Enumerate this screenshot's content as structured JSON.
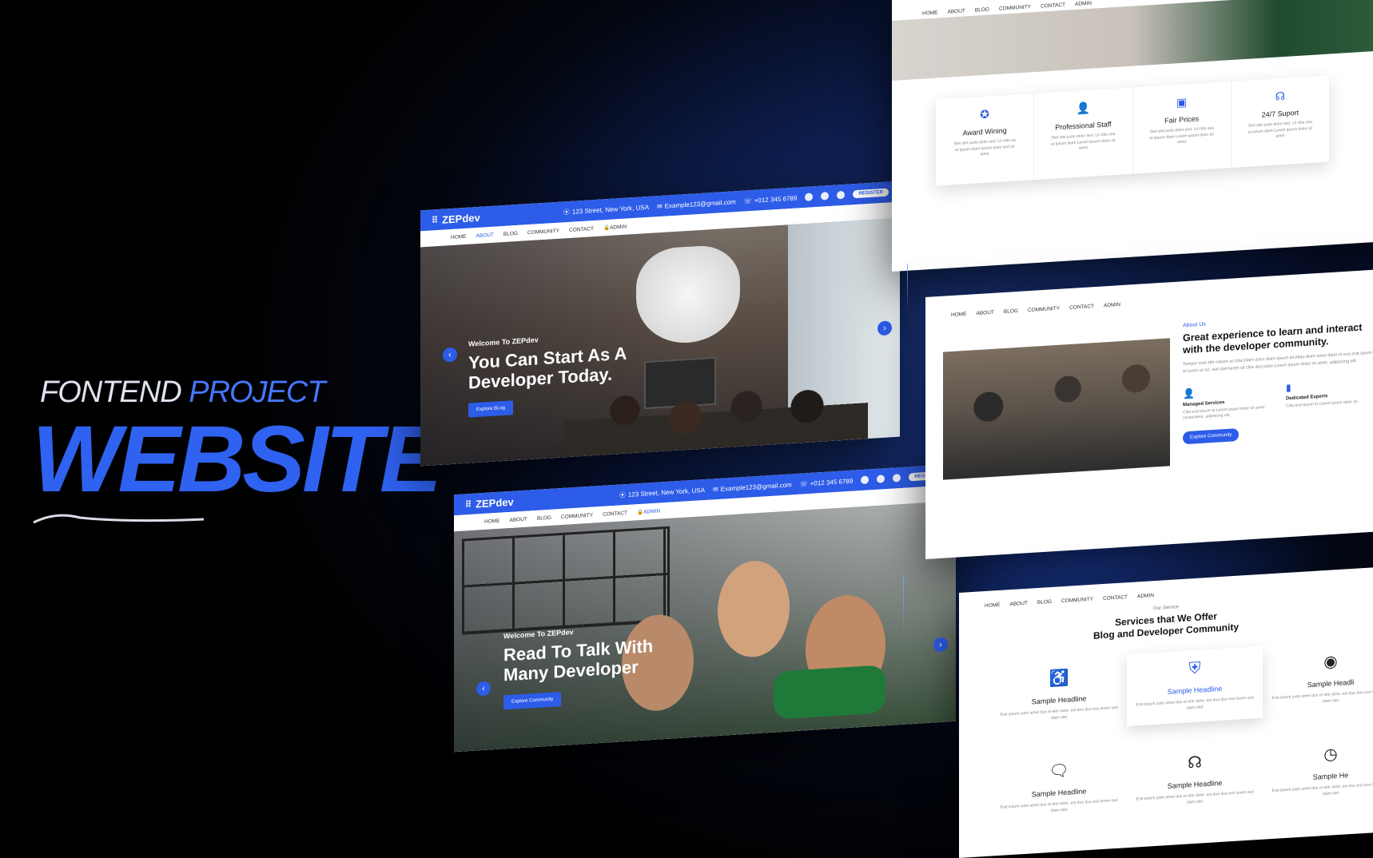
{
  "banner": {
    "subtitle_a": "FONTEND",
    "subtitle_b": "PROJECT",
    "title": "WEBSITE"
  },
  "brand": {
    "name": "ZEPdev",
    "accent": "#2d5ce8"
  },
  "topbar": {
    "address": "123 Street, New York, USA",
    "email": "Example123@gmail.com",
    "phone": "+012 345 6789",
    "register": "REGISTER"
  },
  "nav": {
    "home": "HOME",
    "about": "ABOUT",
    "blog": "BLOG",
    "community": "COMMUNITY",
    "contact": "CONTACT",
    "admin": "ADMIN"
  },
  "slide1": {
    "welcome": "Welcome To ZEPdev",
    "headline": "You Can Start As A Developer Today.",
    "button": "Explore BLog"
  },
  "slide2": {
    "welcome": "Welcome To ZEPdev",
    "headline": "Read To Talk With Many Developer",
    "button": "Explore Community"
  },
  "features": [
    {
      "title": "Award Wining",
      "text": "Stet stet justo dolor sed. Lit clita ea et ipsum diam ipsum dolor sed sit amet",
      "icon": "award-icon"
    },
    {
      "title": "Professional Staff",
      "text": "Stet stet justo dolor sed. Lit clita sea et ipsum diam Lorem ipsum dolor sit amet",
      "icon": "user-check-icon"
    },
    {
      "title": "Fair Prices",
      "text": "Stet stet justo dolor sed. Lit clita sea et ipsum diam Lorem ipsum dolor sit amet",
      "icon": "wallet-icon"
    },
    {
      "title": "24/7 Suport",
      "text": "Stet stet justo dolor sed. Lit clita sea et ipsum diam Lorem ipsum dolor sit amet",
      "icon": "headset-icon"
    }
  ],
  "about": {
    "label": "About Us",
    "heading": "Great experience to learn and interact with the developer community.",
    "text": "Tempor erat elitr rebum at clita Diam dolor diam ipsum sit Aliqu diam amet diam et eos erat ipsum et lorem et sit, sed stet lorem sit clita duo justo Lorem ipsum dolor sit amet, adipiscing elit.",
    "services": [
      {
        "title": "Managed Services",
        "text": "Clita erat ipsum et Lorem ipsum dolor sit amet consectetur, adipiscing elit.",
        "icon": "user-check-icon"
      },
      {
        "title": "Dedicated Experts",
        "text": "Clita erat ipsum et Lorem ipsum dolor sit.",
        "icon": "id-badge-icon"
      }
    ],
    "button": "Explore Community"
  },
  "services": {
    "label": "Our Service",
    "heading_line1": "Services that We Offer",
    "heading_line2": "Blog and Developer Community",
    "cards": [
      {
        "title": "Sample Headline",
        "text": "Erat ipsum justo amet duo et elitr dolor, est duo duo eos lorem sed diam stet",
        "icon": "accessibility-icon"
      },
      {
        "title": "Sample Headline",
        "text": "Erat ipsum justo amet duo et elitr dolor, est duo duo eos lorem sed diam stet",
        "icon": "shield-plus-icon"
      },
      {
        "title": "Sample Headli",
        "text": "Erat ipsum justo amet duo et elitr dolor, est duo duo eos lorem sed diam stet",
        "icon": "user-circle-icon"
      },
      {
        "title": "Sample Headline",
        "text": "Erat ipsum justo amet duo et elitr dolor, est duo duo eos lorem sed diam stet",
        "icon": "chat-icon"
      },
      {
        "title": "Sample Headline",
        "text": "Erat ipsum justo amet duo et elitr dolor, est duo duo eos lorem sed diam stet",
        "icon": "headset-icon"
      },
      {
        "title": "Sample He",
        "text": "Erat ipsum justo amet duo et elitr dolor, est duo duo eos lorem sed diam stet",
        "icon": "clock-icon"
      }
    ]
  }
}
